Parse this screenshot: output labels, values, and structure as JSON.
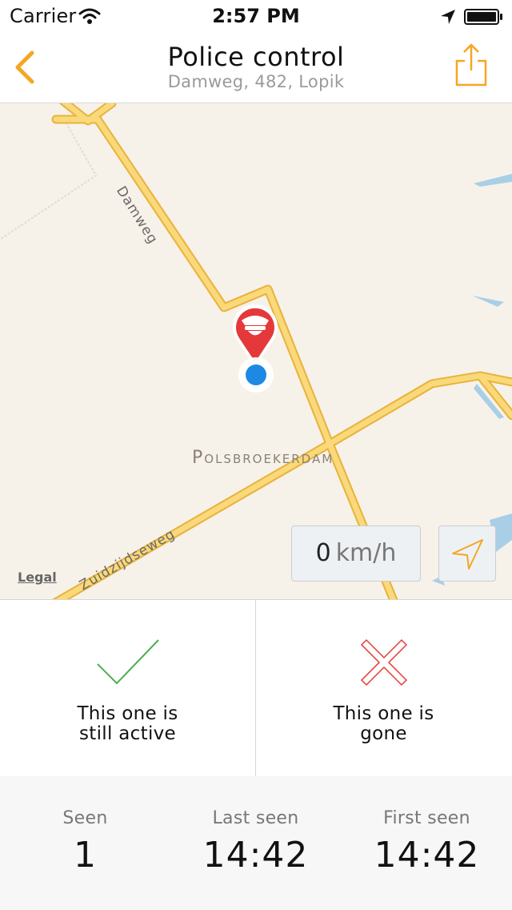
{
  "status_bar": {
    "carrier": "Carrier",
    "time": "2:57 PM",
    "icons": [
      "wifi-icon",
      "location-arrow-icon",
      "battery-icon"
    ]
  },
  "nav": {
    "title": "Police control",
    "subtitle": "Damweg, 482, Lopik",
    "back_icon": "chevron-left-icon",
    "share_icon": "share-icon"
  },
  "map": {
    "streets": [
      "Damweg",
      "Zuidzijdseweg"
    ],
    "place": "Polsbroekerdam",
    "legal": "Legal",
    "speed": {
      "value": "0",
      "unit": "km/h"
    },
    "pin_icon": "police-pin-icon",
    "locate_icon": "location-arrow-icon"
  },
  "actions": {
    "active": {
      "line1": "This one is",
      "line2": "still active",
      "icon": "checkmark-icon"
    },
    "gone": {
      "line1": "This one is",
      "line2": "gone",
      "icon": "cross-icon"
    }
  },
  "stats": {
    "seen": {
      "label": "Seen",
      "value": "1"
    },
    "last_seen": {
      "label": "Last seen",
      "value": "14:42"
    },
    "first_seen": {
      "label": "First seen",
      "value": "14:42"
    }
  },
  "colors": {
    "accent": "#f5a623",
    "road": "#f6c552",
    "pin": "#e5383b",
    "user_dot": "#1e88e5",
    "check": "#4caf50",
    "cross": "#e53935"
  }
}
